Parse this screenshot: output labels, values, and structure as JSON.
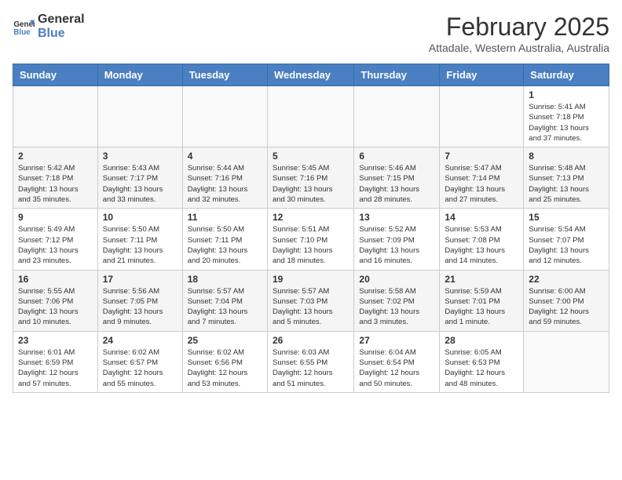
{
  "logo": {
    "line1": "General",
    "line2": "Blue"
  },
  "title": "February 2025",
  "location": "Attadale, Western Australia, Australia",
  "days_header": [
    "Sunday",
    "Monday",
    "Tuesday",
    "Wednesday",
    "Thursday",
    "Friday",
    "Saturday"
  ],
  "weeks": [
    [
      {
        "day": "",
        "info": ""
      },
      {
        "day": "",
        "info": ""
      },
      {
        "day": "",
        "info": ""
      },
      {
        "day": "",
        "info": ""
      },
      {
        "day": "",
        "info": ""
      },
      {
        "day": "",
        "info": ""
      },
      {
        "day": "1",
        "info": "Sunrise: 5:41 AM\nSunset: 7:18 PM\nDaylight: 13 hours\nand 37 minutes."
      }
    ],
    [
      {
        "day": "2",
        "info": "Sunrise: 5:42 AM\nSunset: 7:18 PM\nDaylight: 13 hours\nand 35 minutes."
      },
      {
        "day": "3",
        "info": "Sunrise: 5:43 AM\nSunset: 7:17 PM\nDaylight: 13 hours\nand 33 minutes."
      },
      {
        "day": "4",
        "info": "Sunrise: 5:44 AM\nSunset: 7:16 PM\nDaylight: 13 hours\nand 32 minutes."
      },
      {
        "day": "5",
        "info": "Sunrise: 5:45 AM\nSunset: 7:16 PM\nDaylight: 13 hours\nand 30 minutes."
      },
      {
        "day": "6",
        "info": "Sunrise: 5:46 AM\nSunset: 7:15 PM\nDaylight: 13 hours\nand 28 minutes."
      },
      {
        "day": "7",
        "info": "Sunrise: 5:47 AM\nSunset: 7:14 PM\nDaylight: 13 hours\nand 27 minutes."
      },
      {
        "day": "8",
        "info": "Sunrise: 5:48 AM\nSunset: 7:13 PM\nDaylight: 13 hours\nand 25 minutes."
      }
    ],
    [
      {
        "day": "9",
        "info": "Sunrise: 5:49 AM\nSunset: 7:12 PM\nDaylight: 13 hours\nand 23 minutes."
      },
      {
        "day": "10",
        "info": "Sunrise: 5:50 AM\nSunset: 7:11 PM\nDaylight: 13 hours\nand 21 minutes."
      },
      {
        "day": "11",
        "info": "Sunrise: 5:50 AM\nSunset: 7:11 PM\nDaylight: 13 hours\nand 20 minutes."
      },
      {
        "day": "12",
        "info": "Sunrise: 5:51 AM\nSunset: 7:10 PM\nDaylight: 13 hours\nand 18 minutes."
      },
      {
        "day": "13",
        "info": "Sunrise: 5:52 AM\nSunset: 7:09 PM\nDaylight: 13 hours\nand 16 minutes."
      },
      {
        "day": "14",
        "info": "Sunrise: 5:53 AM\nSunset: 7:08 PM\nDaylight: 13 hours\nand 14 minutes."
      },
      {
        "day": "15",
        "info": "Sunrise: 5:54 AM\nSunset: 7:07 PM\nDaylight: 13 hours\nand 12 minutes."
      }
    ],
    [
      {
        "day": "16",
        "info": "Sunrise: 5:55 AM\nSunset: 7:06 PM\nDaylight: 13 hours\nand 10 minutes."
      },
      {
        "day": "17",
        "info": "Sunrise: 5:56 AM\nSunset: 7:05 PM\nDaylight: 13 hours\nand 9 minutes."
      },
      {
        "day": "18",
        "info": "Sunrise: 5:57 AM\nSunset: 7:04 PM\nDaylight: 13 hours\nand 7 minutes."
      },
      {
        "day": "19",
        "info": "Sunrise: 5:57 AM\nSunset: 7:03 PM\nDaylight: 13 hours\nand 5 minutes."
      },
      {
        "day": "20",
        "info": "Sunrise: 5:58 AM\nSunset: 7:02 PM\nDaylight: 13 hours\nand 3 minutes."
      },
      {
        "day": "21",
        "info": "Sunrise: 5:59 AM\nSunset: 7:01 PM\nDaylight: 13 hours\nand 1 minute."
      },
      {
        "day": "22",
        "info": "Sunrise: 6:00 AM\nSunset: 7:00 PM\nDaylight: 12 hours\nand 59 minutes."
      }
    ],
    [
      {
        "day": "23",
        "info": "Sunrise: 6:01 AM\nSunset: 6:59 PM\nDaylight: 12 hours\nand 57 minutes."
      },
      {
        "day": "24",
        "info": "Sunrise: 6:02 AM\nSunset: 6:57 PM\nDaylight: 12 hours\nand 55 minutes."
      },
      {
        "day": "25",
        "info": "Sunrise: 6:02 AM\nSunset: 6:56 PM\nDaylight: 12 hours\nand 53 minutes."
      },
      {
        "day": "26",
        "info": "Sunrise: 6:03 AM\nSunset: 6:55 PM\nDaylight: 12 hours\nand 51 minutes."
      },
      {
        "day": "27",
        "info": "Sunrise: 6:04 AM\nSunset: 6:54 PM\nDaylight: 12 hours\nand 50 minutes."
      },
      {
        "day": "28",
        "info": "Sunrise: 6:05 AM\nSunset: 6:53 PM\nDaylight: 12 hours\nand 48 minutes."
      },
      {
        "day": "",
        "info": ""
      }
    ]
  ]
}
